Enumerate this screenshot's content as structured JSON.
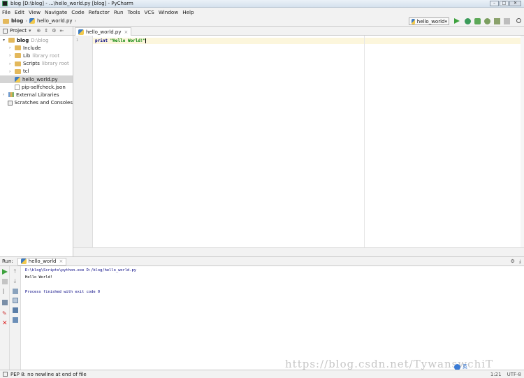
{
  "window": {
    "title": "blog [D:\\blog] - ...\\hello_world.py [blog] - PyCharm",
    "controls": [
      "–",
      "□",
      "✕"
    ]
  },
  "menu": [
    "File",
    "Edit",
    "View",
    "Navigate",
    "Code",
    "Refactor",
    "Run",
    "Tools",
    "VCS",
    "Window",
    "Help"
  ],
  "navbar": {
    "crumbs": [
      "blog",
      "hello_world.py"
    ],
    "run_config": "hello_world"
  },
  "project": {
    "header": "Project",
    "tree": [
      {
        "label": "blog",
        "hint": "D:\\blog",
        "level": 0,
        "expanded": true,
        "bold": true,
        "icon": "folder-icon"
      },
      {
        "label": "Include",
        "hint": "",
        "level": 1,
        "expanded": false,
        "icon": "folder-icon"
      },
      {
        "label": "Lib",
        "hint": "library root",
        "level": 1,
        "expanded": false,
        "icon": "folder-icon"
      },
      {
        "label": "Scripts",
        "hint": "library root",
        "level": 1,
        "expanded": false,
        "icon": "folder-icon"
      },
      {
        "label": "tcl",
        "hint": "",
        "level": 1,
        "expanded": false,
        "icon": "folder-icon"
      },
      {
        "label": "hello_world.py",
        "hint": "",
        "level": 1,
        "selected": true,
        "icon": "python-file-icon"
      },
      {
        "label": "pip-selfcheck.json",
        "hint": "",
        "level": 1,
        "icon": "json-file-icon"
      },
      {
        "label": "External Libraries",
        "hint": "",
        "level": 0,
        "expanded": false,
        "icon": "library-icon"
      },
      {
        "label": "Scratches and Consoles",
        "hint": "",
        "level": 0,
        "icon": "scratch-icon"
      }
    ]
  },
  "editor": {
    "tab": "hello_world.py",
    "line_number": "1",
    "code_keyword": "print",
    "code_string": "\"Hello World!\""
  },
  "run": {
    "label": "Run:",
    "tab": "hello_world",
    "console": [
      "D:\\blog\\Scripts\\python.exe D:/blog/hello_world.py",
      "Hello World!",
      "",
      "Process finished with exit code 0"
    ]
  },
  "status": {
    "message": "PEP 8: no newline at end of file",
    "position": "1:21",
    "encoding": "UTF-8",
    "watermark": "https://blog.csdn.net/TywanswchiT",
    "ime_label": "英"
  },
  "colors": {
    "run_green": "#3ea23e",
    "keyword": "#000080",
    "string": "#008000",
    "selection": "#d4d4d4"
  }
}
